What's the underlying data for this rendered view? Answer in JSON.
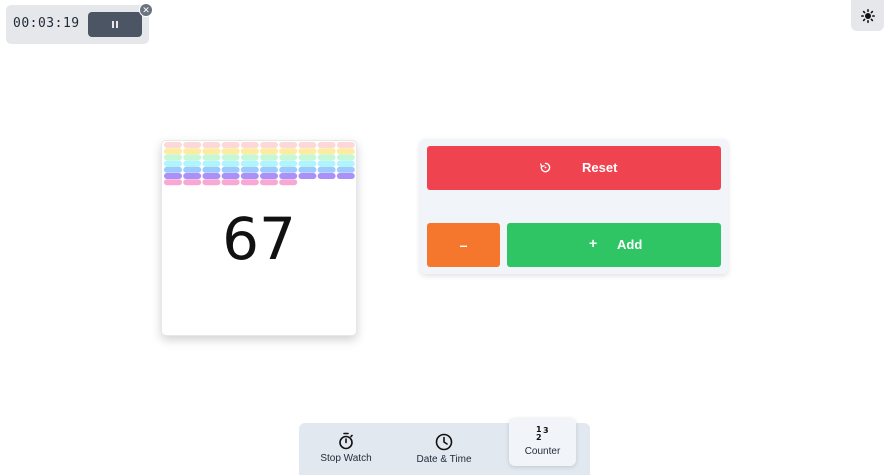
{
  "mini_timer": {
    "time": "00:03:19",
    "close_symbol": "✕"
  },
  "counter": {
    "value": "67"
  },
  "controls": {
    "reset_label": "Reset",
    "minus_label": "–",
    "add_icon": "+",
    "add_label": "Add"
  },
  "nav": {
    "items": [
      {
        "label": "Stop Watch",
        "icon": "stopwatch-icon"
      },
      {
        "label": "Date & Time",
        "icon": "clock-icon"
      },
      {
        "label": "Counter",
        "icon": "numbers-icon",
        "active": true
      }
    ]
  },
  "colors": {
    "reset": "#ef4350",
    "minus": "#f5762d",
    "add": "#30c564",
    "pill_rows": [
      "#fecaca",
      "#fde68a",
      "#bbf7d0",
      "#a5f3fc",
      "#93c5fd",
      "#a78bfa",
      "#f9a8d4"
    ]
  }
}
